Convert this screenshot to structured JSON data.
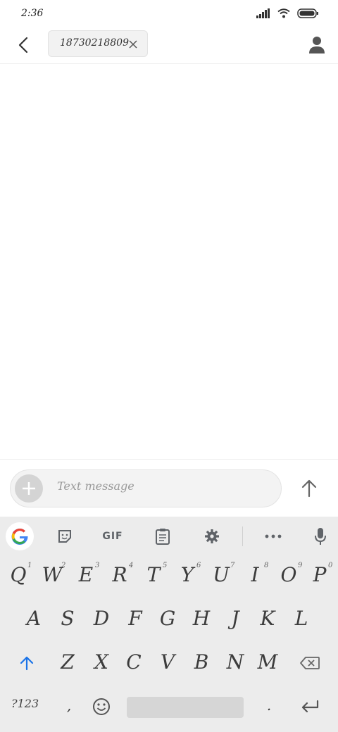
{
  "status_bar": {
    "time": "2:36",
    "icons": [
      "signal-icon",
      "wifi-icon",
      "battery-icon"
    ]
  },
  "header": {
    "recipient": "18730218809"
  },
  "compose": {
    "placeholder": "Text message"
  },
  "keyboard": {
    "toolbar": {
      "gif_label": "GIF"
    },
    "row1": [
      {
        "key": "Q",
        "hint": "1"
      },
      {
        "key": "W",
        "hint": "2"
      },
      {
        "key": "E",
        "hint": "3"
      },
      {
        "key": "R",
        "hint": "4"
      },
      {
        "key": "T",
        "hint": "5"
      },
      {
        "key": "Y",
        "hint": "6"
      },
      {
        "key": "U",
        "hint": "7"
      },
      {
        "key": "I",
        "hint": "8"
      },
      {
        "key": "O",
        "hint": "9"
      },
      {
        "key": "P",
        "hint": "0"
      }
    ],
    "row2": [
      "A",
      "S",
      "D",
      "F",
      "G",
      "H",
      "J",
      "K",
      "L"
    ],
    "row3": [
      "Z",
      "X",
      "C",
      "V",
      "B",
      "N",
      "M"
    ],
    "bottom": {
      "symbols": "?123",
      "comma": ",",
      "period": "."
    }
  }
}
